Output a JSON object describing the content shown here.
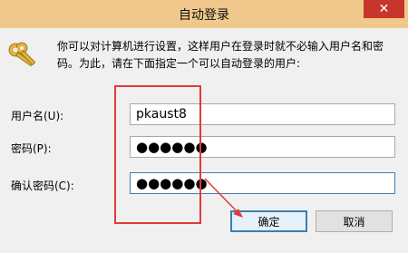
{
  "window": {
    "title": "自动登录",
    "close_glyph": "✕"
  },
  "description": "你可以对计算机进行设置，这样用户在登录时就不必输入用户名和密码。为此，请在下面指定一个可以自动登录的用户:",
  "form": {
    "username_label": "用户名(U):",
    "username_value": "pkaust8",
    "password_label": "密码(P):",
    "password_value": "●●●●●●",
    "confirm_label": "确认密码(C):",
    "confirm_value": "●●●●●●"
  },
  "buttons": {
    "ok": "确定",
    "cancel": "取消"
  },
  "colors": {
    "titlebar": "#f0c88b",
    "close": "#c7362a",
    "annotation": "#e23a3a",
    "focus": "#3c7fb1"
  },
  "icons": {
    "dialog": "keys-icon",
    "close": "close-icon"
  }
}
